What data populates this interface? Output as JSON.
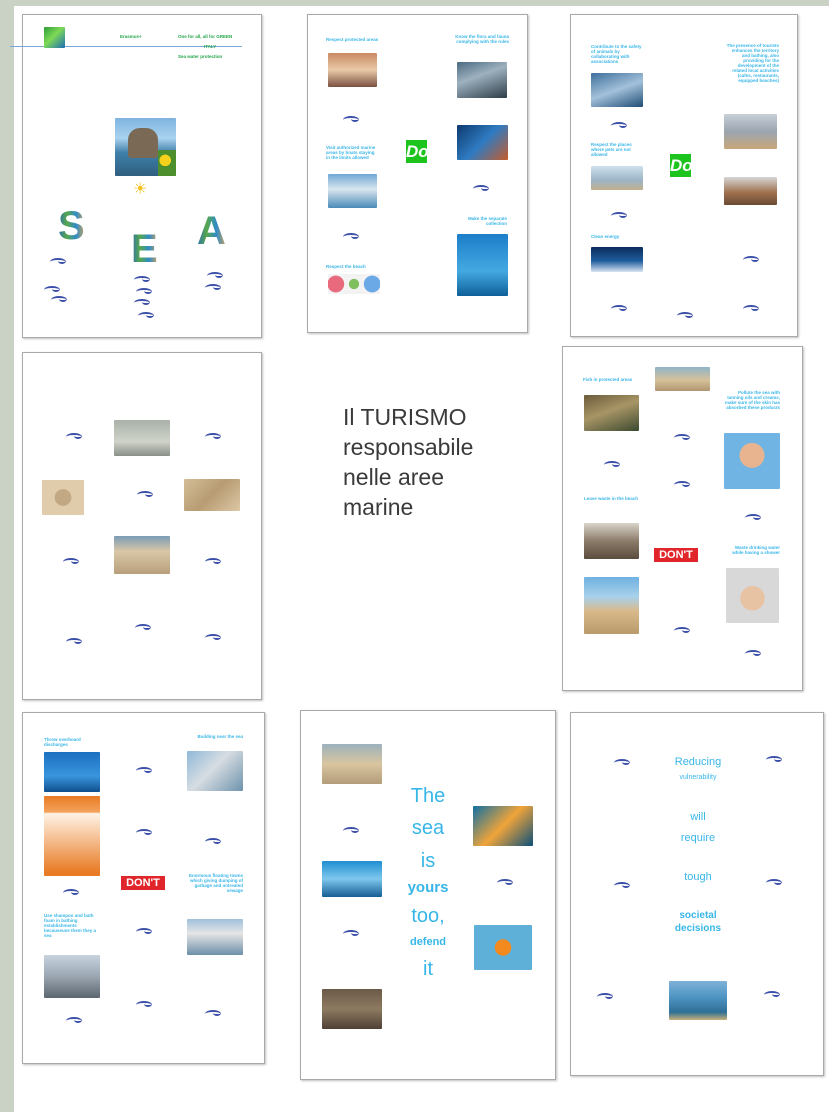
{
  "colors": {
    "accent": "#38b6e8",
    "wave": "#3b4fa8",
    "do_badge": "#1ec41e",
    "dont_badge": "#e0262b",
    "sidebar": "#c9d2c5"
  },
  "center_title": {
    "line1": "Il TURISMO",
    "line2": "responsabile",
    "line3": "nelle aree",
    "line4": "marine"
  },
  "p1": {
    "erasmus": "Erasmus+",
    "header_line1": "One for all, all for GREEN",
    "header_line2": "ITALY",
    "header_line3": "Sea water protection",
    "letter_s": "S",
    "letter_e": "E",
    "letter_a": "A",
    "sun_icon": "sun-icon"
  },
  "p2": {
    "do_label": "Do",
    "c1": "Respect protected areas",
    "c2": "Know the flora and fauna complying with the rules",
    "c3": "Visit authorized marine areas by boats staying in the limits allowed",
    "c4": "Make the separate collection",
    "c5": "Respect the beach"
  },
  "p3": {
    "do_label": "Do",
    "c1": "Contribute to the safety of animals by collaborating with associations",
    "c2": "The presence of tourists enhances the territory and bathing, also providing for the development of the related local activities (cafes, restaurants, equipped beaches)",
    "c3": "Respect the places where pets are not allowed",
    "c4": "Clean energy"
  },
  "p5": {
    "dont_label": "DON'T",
    "c1": "Fish in protected areas",
    "c2": "Pollute the sea with tanning oils and creams, make sure of the skin has absorbed these products",
    "c3": "Leave waste in the beach",
    "c4": "Waste drinking water while having a shower"
  },
  "p6": {
    "dont_label": "DON'T",
    "c1": "Throw overboard discharges",
    "c2": "Building near the sea",
    "c3": "Enormous floating towns which giving dumping of garbage and untreated sewage",
    "c4": "Use shampoo and bath foam in bathing establishments becauseuse them they a sea"
  },
  "p8": {
    "l1": "The",
    "l2": "sea",
    "l3": "is",
    "l4": "yours",
    "l5": "too,",
    "l6": "defend",
    "l7": "it"
  },
  "p9": {
    "l1": "Reducing",
    "l2": "vulnerability",
    "l3": "will",
    "l4": "require",
    "l5": "tough",
    "l6": "societal",
    "l7": "decisions"
  }
}
